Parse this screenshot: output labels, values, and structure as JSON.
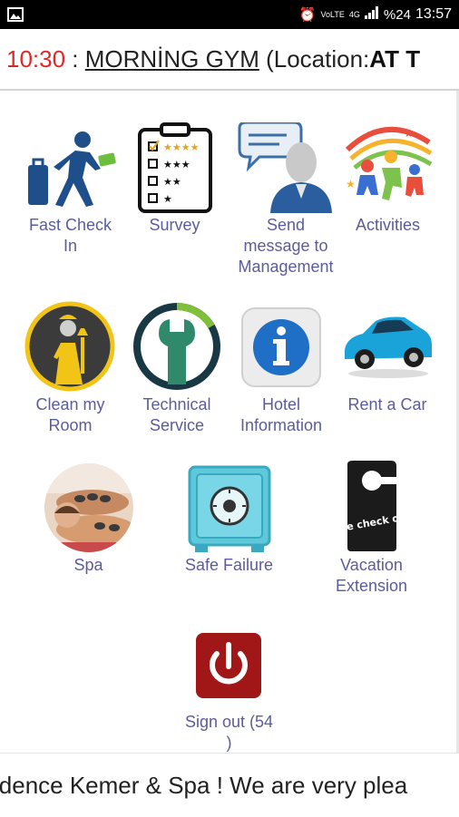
{
  "status_bar": {
    "left_icon": "gallery-icon",
    "network_label": "VoLTE",
    "network_type": "4G",
    "battery": "%24",
    "time": "13:57"
  },
  "ticker": {
    "time": "10:30",
    "separator": " : ",
    "event": "MORNİNG GYM",
    "location_label": " (Location:",
    "location_value": "AT T"
  },
  "menu": {
    "fast_check_in": "Fast Check In",
    "survey": "Survey",
    "send_message": "Send message to Management",
    "activities": "Activities",
    "clean_room": "Clean my Room",
    "technical_service": "Technical Service",
    "hotel_information": "Hotel Information",
    "rent_a_car": "Rent a Car",
    "spa": "Spa",
    "safe_failure": "Safe Failure",
    "vacation_extension": "Vacation Extension",
    "sign_out": "Sign out (54 )"
  },
  "door_hanger_text": "late check out",
  "bottom_marquee": "sidence Kemer & Spa ! We are very plea",
  "colors": {
    "label": "#5b5c9a",
    "ticker_time": "#e0282a",
    "signout_red": "#b01a1a"
  }
}
